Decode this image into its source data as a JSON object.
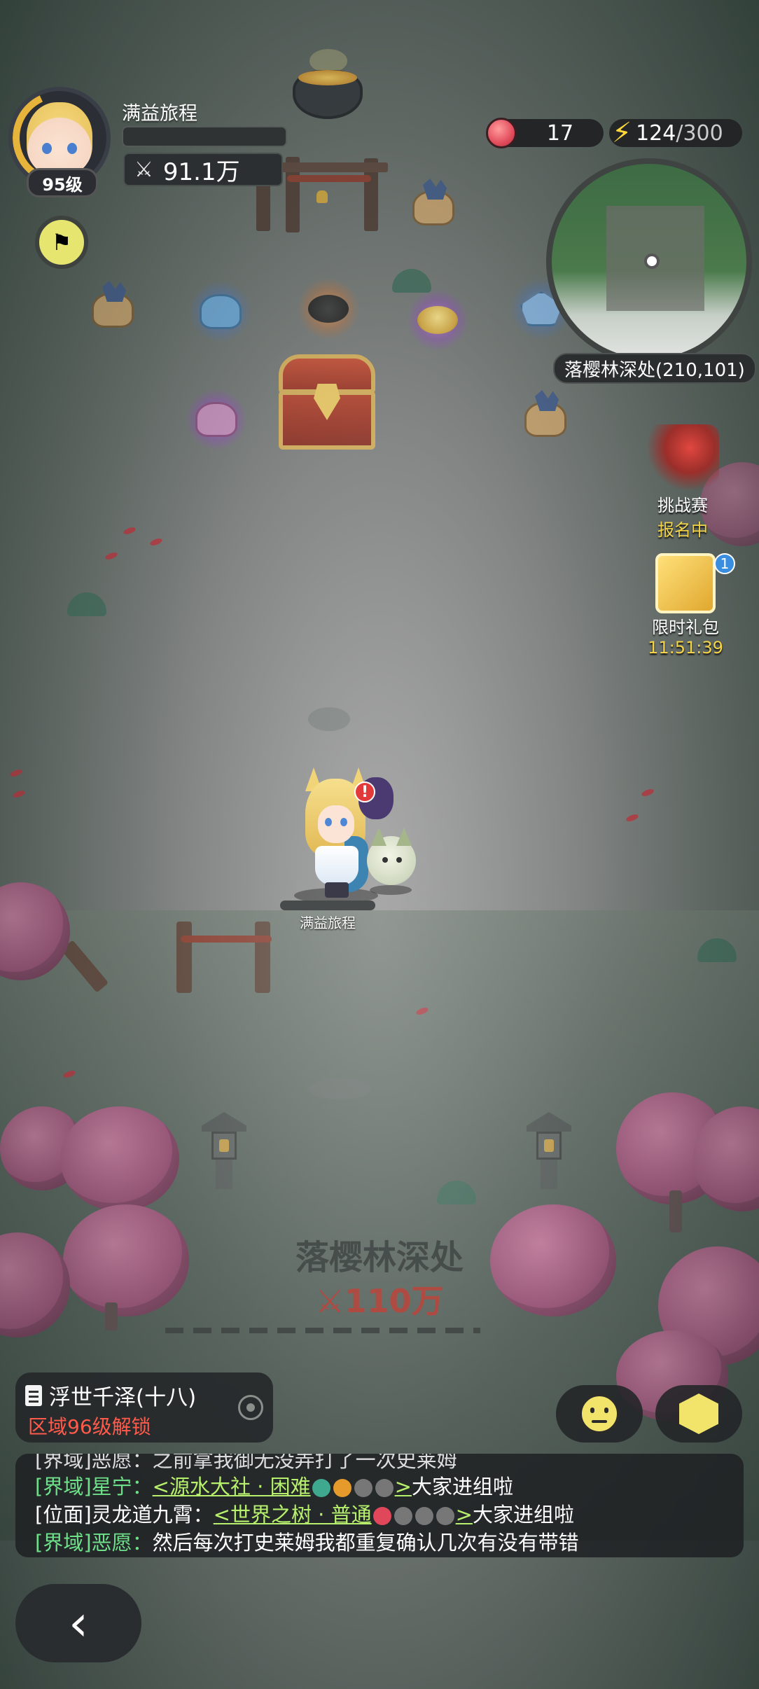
{
  "player": {
    "name": "满益旅程",
    "level": "95级",
    "power": "91.1万"
  },
  "resources": {
    "apples": "17",
    "energy_current": "124",
    "energy_max": "/300"
  },
  "minimap": {
    "location": "落樱林深处(210,101)"
  },
  "side_buttons": {
    "challenge": {
      "label": "挑战赛",
      "status": "报名中"
    },
    "gift": {
      "label": "限时礼包",
      "timer": "11:51:39",
      "badge": "1"
    }
  },
  "character_label": "满益旅程",
  "area": {
    "title": "落樱林深处",
    "power": "110万"
  },
  "quest": {
    "title": "浮世千泽(十八)",
    "subtitle": "区域96级解锁"
  },
  "chat": {
    "partial_line": "[界域]恶愿：之前拿我御无没弄打了一次史莱姆",
    "lines": [
      {
        "channel": "[界域]",
        "sender": "星宁：",
        "link": "<源水大社 · 困难",
        "link_end": ">",
        "message": "大家进组啦"
      },
      {
        "channel": "[位面]",
        "sender": "灵龙道九霄：",
        "link": "<世界之树 · 普通",
        "link_end": ">",
        "message": "大家进组啦"
      },
      {
        "channel": "[界域]",
        "sender": "恶愿：",
        "message": "然后每次打史莱姆我都重复确认几次有没有带错"
      }
    ]
  },
  "icons": {
    "flag": "flag-list-icon",
    "power": "crossed-swords-icon",
    "energy": "lightning-icon",
    "apple": "apple-icon",
    "back": "chevron-left-icon",
    "emote": "emoji-face-icon",
    "bag": "cube-icon"
  },
  "colors": {
    "level_ring": "#e6b43a",
    "accent_yellow": "#f2e46a",
    "alert_red": "#ff5a4a",
    "chat_channel_green": "#6fe08a",
    "chat_link_green": "#b7f06c"
  }
}
